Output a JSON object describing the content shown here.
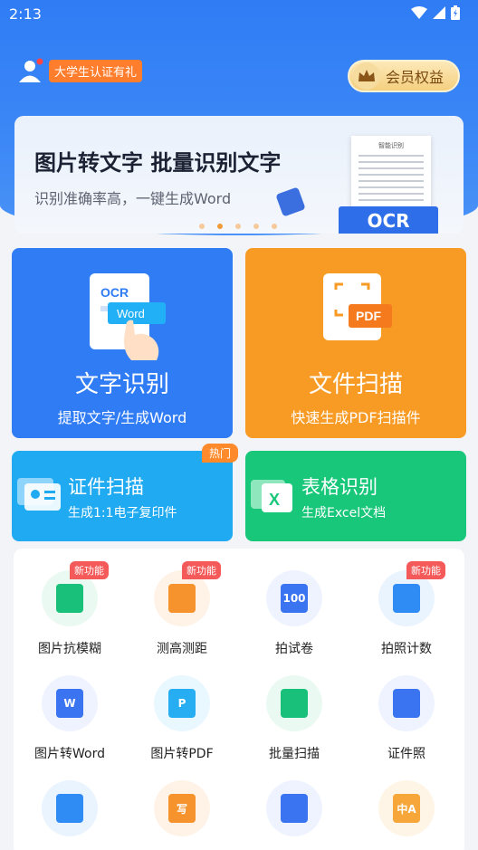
{
  "status_bar": {
    "time": "2:13"
  },
  "header": {
    "auth_badge": "大学生认证有礼",
    "vip_label": "会员权益"
  },
  "banner": {
    "title": "图片转文字 批量识别文字",
    "subtitle": "识别准确率高，一键生成Word",
    "ocr_tag": "OCR",
    "doc_heading": "智能识别"
  },
  "main_cards": {
    "ocr": {
      "icon_ocr": "OCR",
      "icon_word": "Word",
      "title": "文字识别",
      "subtitle": "提取文字/生成Word"
    },
    "scan": {
      "icon_pdf": "PDF",
      "title": "文件扫描",
      "subtitle": "快速生成PDF扫描件"
    },
    "id_scan": {
      "badge": "热门",
      "title": "证件扫描",
      "subtitle": "生成1:1电子复印件"
    },
    "table": {
      "icon_x": "X",
      "title": "表格识别",
      "subtitle": "生成Excel文档"
    }
  },
  "tools": [
    {
      "label": "图片抗模糊",
      "badge": "新功能",
      "icon": "image-deblur-icon",
      "color": "#19c07a"
    },
    {
      "label": "测高测距",
      "badge": "新功能",
      "icon": "ruler-icon",
      "color": "#f7932c"
    },
    {
      "label": "拍试卷",
      "badge": "",
      "icon": "exam-paper-icon",
      "color": "#3a74f0",
      "glyph": "100"
    },
    {
      "label": "拍照计数",
      "badge": "新功能",
      "icon": "camera-count-icon",
      "color": "#2f8cf5"
    },
    {
      "label": "图片转Word",
      "badge": "",
      "icon": "word-icon",
      "color": "#3a74f0",
      "glyph": "W"
    },
    {
      "label": "图片转PDF",
      "badge": "",
      "icon": "image-pdf-icon",
      "color": "#27aef2",
      "glyph": "P"
    },
    {
      "label": "批量扫描",
      "badge": "",
      "icon": "batch-scan-icon",
      "color": "#19c07a"
    },
    {
      "label": "证件照",
      "badge": "",
      "icon": "id-photo-icon",
      "color": "#3a74f0"
    },
    {
      "label": "",
      "badge": "",
      "icon": "image-stitch-icon",
      "color": "#2f8cf5"
    },
    {
      "label": "",
      "badge": "",
      "icon": "handwriting-icon",
      "color": "#f7932c",
      "glyph": "写"
    },
    {
      "label": "",
      "badge": "",
      "icon": "doc-search-icon",
      "color": "#3a74f0"
    },
    {
      "label": "",
      "badge": "",
      "icon": "translate-icon",
      "color": "#f7a63a",
      "glyph": "中A"
    }
  ]
}
